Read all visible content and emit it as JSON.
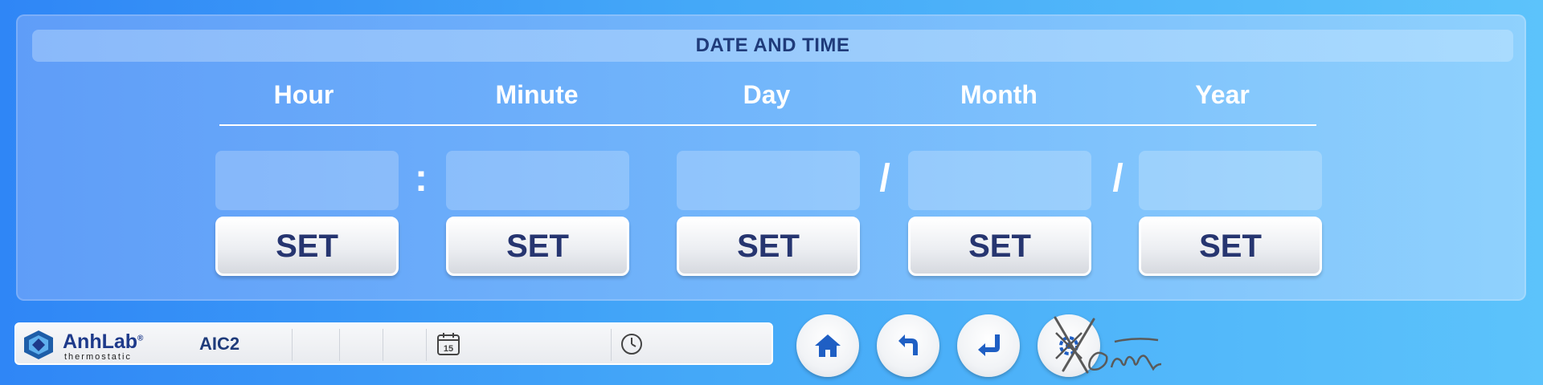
{
  "panel": {
    "title": "DATE AND TIME",
    "columns": [
      {
        "label": "Hour",
        "value": "",
        "button": "SET"
      },
      {
        "label": "Minute",
        "value": "",
        "button": "SET"
      },
      {
        "label": "Day",
        "value": "",
        "button": "SET"
      },
      {
        "label": "Month",
        "value": "",
        "button": "SET"
      },
      {
        "label": "Year",
        "value": "",
        "button": "SET"
      }
    ],
    "separators": [
      ":",
      "/",
      "/"
    ]
  },
  "statusbar": {
    "brand": "AnhLab",
    "brand_mark": "®",
    "brand_sub": "thermostatic",
    "device": "AIC2",
    "calendar_day": "15"
  },
  "nav": {
    "icons": [
      "home-icon",
      "back-icon",
      "enter-icon",
      "settings-disabled-icon"
    ]
  },
  "signature": "Xom"
}
